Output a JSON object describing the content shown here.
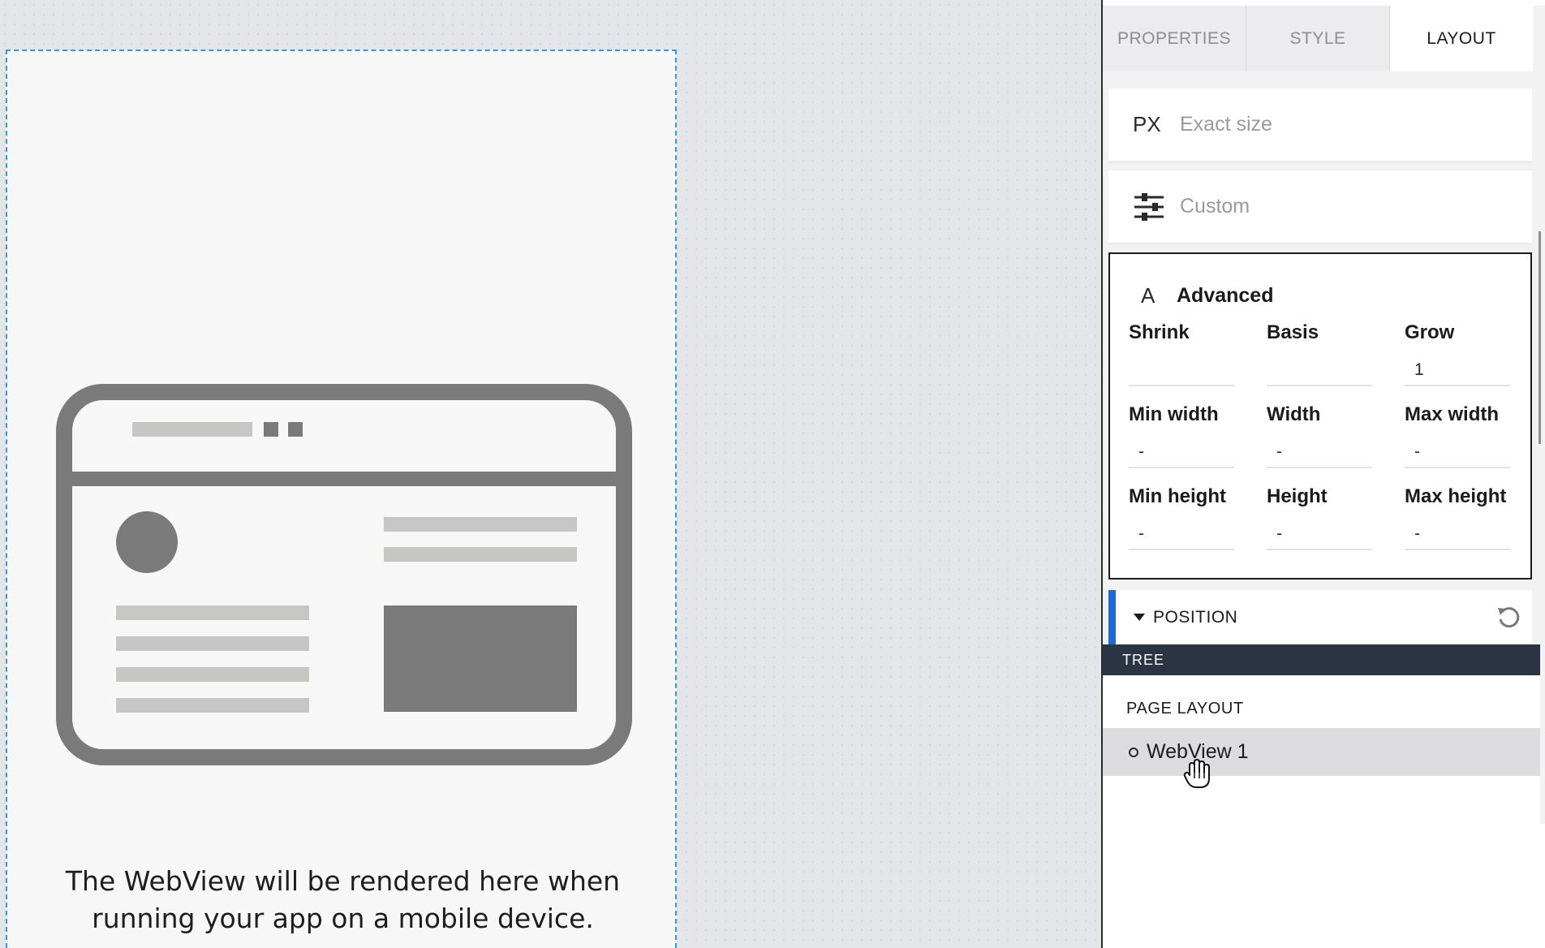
{
  "canvas": {
    "webview_caption_line1": "The WebView will be rendered here when",
    "webview_caption_line2": "running your app on a mobile device."
  },
  "panel": {
    "tabs": [
      {
        "label": "PROPERTIES",
        "active": false
      },
      {
        "label": "STYLE",
        "active": false
      },
      {
        "label": "LAYOUT",
        "active": true
      }
    ],
    "size_options": [
      {
        "icon": "px-icon",
        "icon_text": "PX",
        "label": "Exact size"
      },
      {
        "icon": "sliders-icon",
        "label": "Custom"
      }
    ],
    "advanced": {
      "icon": "letter-a-icon",
      "icon_text": "A",
      "title": "Advanced",
      "fields": {
        "shrink": {
          "label": "Shrink",
          "value": ""
        },
        "basis": {
          "label": "Basis",
          "value": ""
        },
        "grow": {
          "label": "Grow",
          "value": "1"
        },
        "min_width": {
          "label": "Min width",
          "value": "-"
        },
        "width": {
          "label": "Width",
          "value": "-"
        },
        "max_width": {
          "label": "Max width",
          "value": "-"
        },
        "min_height": {
          "label": "Min height",
          "value": "-"
        },
        "height": {
          "label": "Height",
          "value": "-"
        },
        "max_height": {
          "label": "Max height",
          "value": "-"
        }
      }
    },
    "position": {
      "label": "POSITION",
      "reset_icon": "reset-icon"
    },
    "tree": {
      "title": "TREE",
      "section": "PAGE LAYOUT",
      "items": [
        {
          "label": "WebView 1",
          "selected": true
        }
      ]
    }
  },
  "colors": {
    "selection_border": "#2c9de2",
    "position_accent": "#1c6ad6",
    "tree_header_bg": "#2b3443",
    "illustration_gray": "#7a7a7a",
    "illustration_light": "#c6c6c5"
  }
}
